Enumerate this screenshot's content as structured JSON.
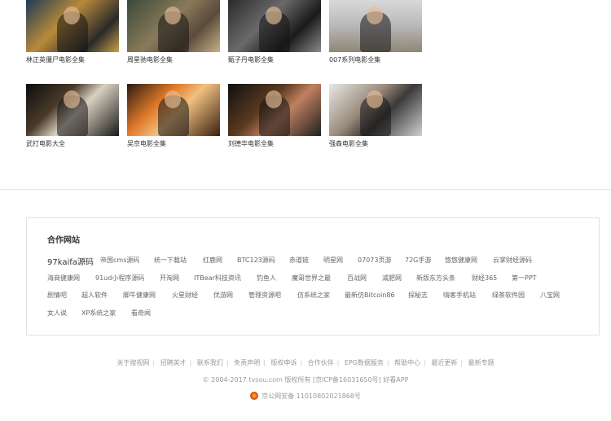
{
  "movies": [
    {
      "title": "林正英僵尸电影全集"
    },
    {
      "title": "周星驰电影全集"
    },
    {
      "title": "甄子丹电影全集"
    },
    {
      "title": "007系列电影全集"
    },
    {
      "title": "武打电影大全"
    },
    {
      "title": "吴京电影全集"
    },
    {
      "title": "刘德华电影全集"
    },
    {
      "title": "强森电影全集"
    }
  ],
  "partner": {
    "title": "合作网站",
    "links": [
      "97kaifa源码",
      "帝国cms源码",
      "统一下载站",
      "红鹿网",
      "BTC123源码",
      "赤道链",
      "明星网",
      "07073页游",
      "72G手游",
      "悠悠健康网",
      "云掌财经源码",
      "海商健康网",
      "91ud小程序源码",
      "开淘网",
      "ITBear科技资讯",
      "钓鱼人",
      "魔哥世界之最",
      "百战网",
      "减肥网",
      "新版东方头条",
      "财经365",
      "第一PPT",
      "剧情吧",
      "超人软件",
      "脚牛健康网",
      "火星财经",
      "优游网",
      "管理资源吧",
      "仿系统之家",
      "最新仿Bitcoin86",
      "探秘志",
      "嗨客手机站",
      "绿茶软件园",
      "八宝网",
      "女人说",
      "XP系统之家",
      "看奇闻"
    ]
  },
  "footer": {
    "links": [
      "关于搜视网",
      "招聘英才",
      "联系我们",
      "免责声明",
      "版权申诉",
      "合作伙伴",
      "EPG数据服务",
      "帮助中心",
      "最近更新",
      "最新专题"
    ],
    "copyright": "© 2004-2017 tvsou.com 版权所有 [京ICP备16031650号] 好看APP",
    "police": "京公网安备 11010802021868号"
  }
}
